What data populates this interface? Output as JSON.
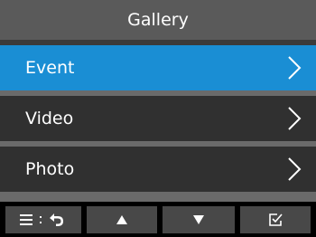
{
  "header": {
    "title": "Gallery"
  },
  "menu": {
    "items": [
      {
        "label": "Event",
        "selected": true
      },
      {
        "label": "Video",
        "selected": false
      },
      {
        "label": "Photo",
        "selected": false
      }
    ]
  },
  "softkeys": [
    {
      "icon": "menu-back-icon"
    },
    {
      "icon": "up-arrow-icon"
    },
    {
      "icon": "down-arrow-icon"
    },
    {
      "icon": "checkbox-icon"
    }
  ],
  "colors": {
    "header_bg": "#5a5a5a",
    "selected_bg": "#1a8ed4",
    "item_bg": "#303030",
    "softkey_bg": "#484848",
    "text": "#ffffff"
  }
}
